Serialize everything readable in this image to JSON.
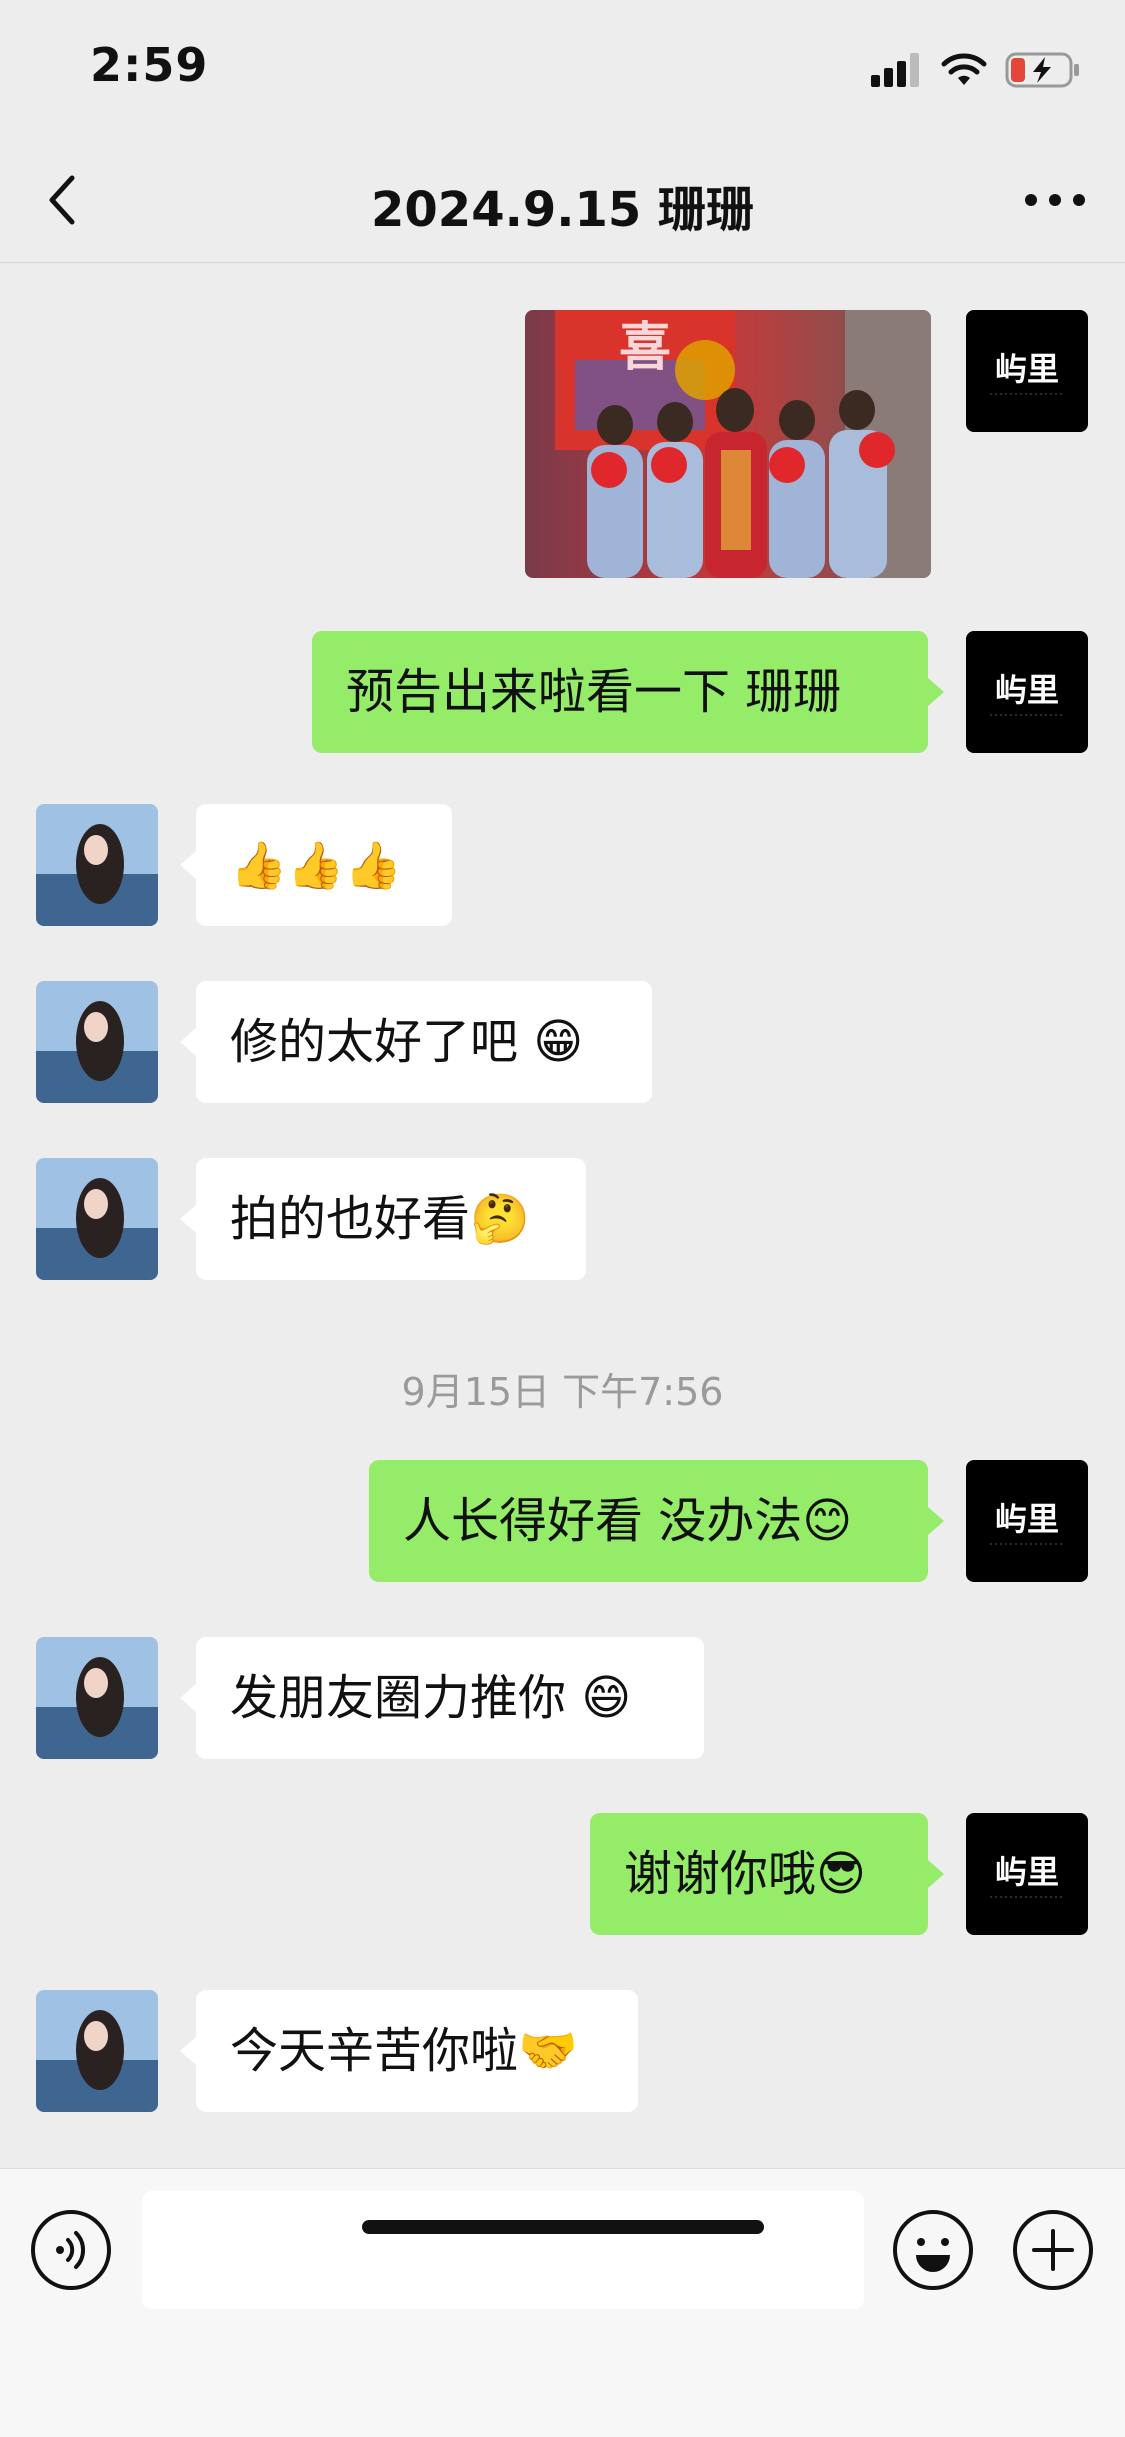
{
  "status_bar": {
    "time": "2:59"
  },
  "nav": {
    "title": "2024.9.15 珊珊"
  },
  "self_avatar": {
    "text": "屿里"
  },
  "messages": [
    {
      "sender": "self",
      "type": "image"
    },
    {
      "sender": "self",
      "text": "预告出来啦看一下  珊珊"
    },
    {
      "sender": "other",
      "text": "👍👍👍"
    },
    {
      "sender": "other",
      "text": "修的太好了吧 😁"
    },
    {
      "sender": "other",
      "text": "拍的也好看🤔"
    },
    {
      "sender": "self",
      "text": "人长得好看 没办法😊"
    },
    {
      "sender": "other",
      "text": "发朋友圈力推你 😄"
    },
    {
      "sender": "self",
      "text": "谢谢你哦😎"
    },
    {
      "sender": "other",
      "text": "今天辛苦你啦🤝"
    }
  ],
  "timestamp": "9月15日 下午7:56",
  "input": {
    "value": "",
    "placeholder": ""
  },
  "icons": {
    "back": "chevron-left-icon",
    "more": "more-dots-icon",
    "voice": "voice-icon",
    "emoji": "emoji-icon",
    "plus": "plus-icon"
  },
  "colors": {
    "self_bubble": "#95ec69",
    "other_bubble": "#ffffff",
    "background": "#ededed"
  }
}
